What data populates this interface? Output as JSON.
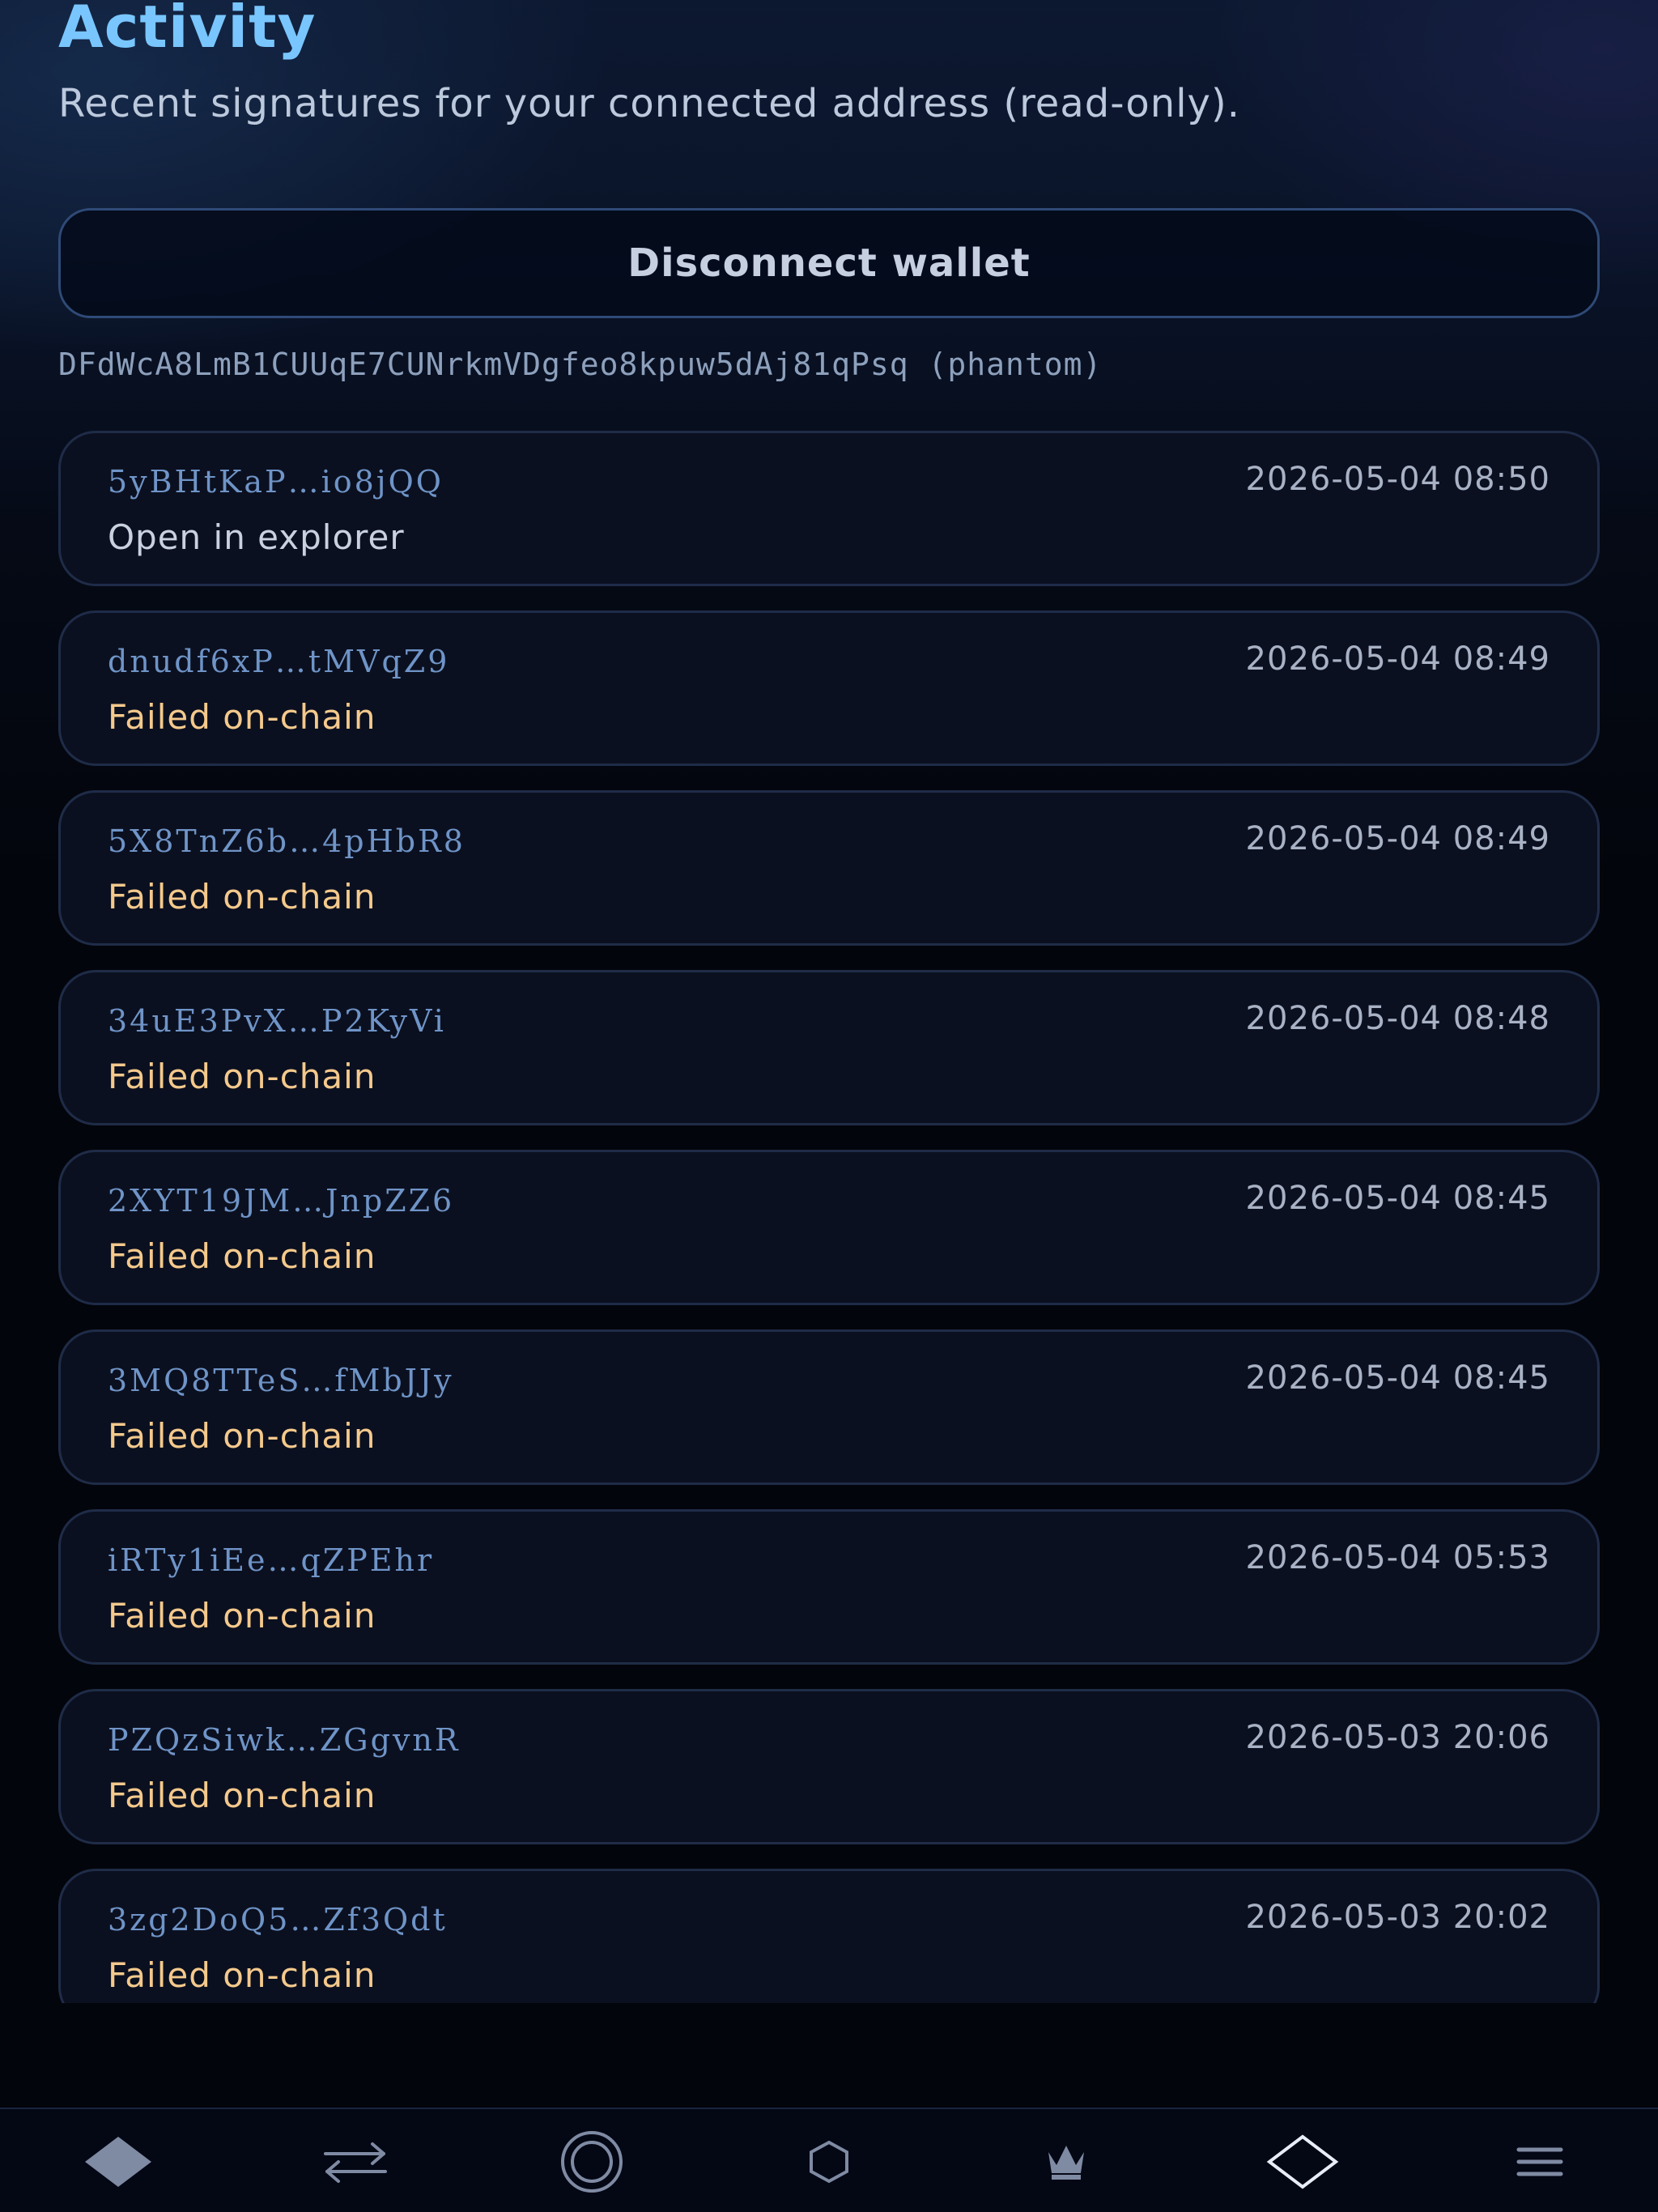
{
  "header": {
    "title": "Activity",
    "subtitle": "Recent signatures for your connected address (read-only)."
  },
  "wallet": {
    "disconnect_label": "Disconnect wallet",
    "address_line": "DFdWcA8LmB1CUUqE7CUNrkmVDgfeo8kpuw5dAj81qPsq (phantom)"
  },
  "activity": [
    {
      "signature": "5yBHtKaP…io8jQQ",
      "time": "2026-05-04 08:50",
      "status": "Open in explorer"
    },
    {
      "signature": "dnudf6xP…tMVqZ9",
      "time": "2026-05-04 08:49",
      "status": "Failed on-chain"
    },
    {
      "signature": "5X8TnZ6b…4pHbR8",
      "time": "2026-05-04 08:49",
      "status": "Failed on-chain"
    },
    {
      "signature": "34uE3PvX…P2KyVi",
      "time": "2026-05-04 08:48",
      "status": "Failed on-chain"
    },
    {
      "signature": "2XYT19JM…JnpZZ6",
      "time": "2026-05-04 08:45",
      "status": "Failed on-chain"
    },
    {
      "signature": "3MQ8TTeS…fMbJJy",
      "time": "2026-05-04 08:45",
      "status": "Failed on-chain"
    },
    {
      "signature": "iRTy1iEe…qZPEhr",
      "time": "2026-05-04 05:53",
      "status": "Failed on-chain"
    },
    {
      "signature": "PZQzSiwk…ZGgvnR",
      "time": "2026-05-03 20:06",
      "status": "Failed on-chain"
    },
    {
      "signature": "3zg2DoQ5…Zf3Qdt",
      "time": "2026-05-03 20:02",
      "status": "Failed on-chain"
    }
  ],
  "colors": {
    "accent": "#79c6ff",
    "failed": "#f4c98c",
    "card_border": "#1f2c48"
  },
  "nav": {
    "items": [
      {
        "icon": "home-diamond-icon"
      },
      {
        "icon": "swap-arrows-icon"
      },
      {
        "icon": "circle-ring-icon"
      },
      {
        "icon": "hexagon-icon"
      },
      {
        "icon": "crown-icon"
      },
      {
        "icon": "activity-diamond-icon"
      },
      {
        "icon": "menu-icon"
      }
    ]
  }
}
